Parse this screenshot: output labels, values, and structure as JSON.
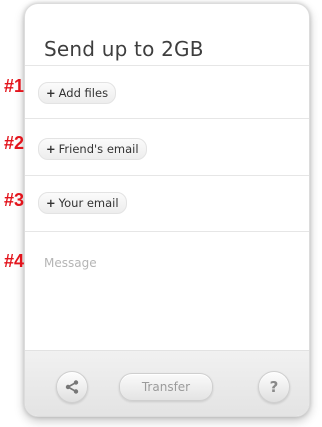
{
  "card": {
    "title": "Send up to 2GB",
    "add_files": "Add files",
    "friends_email": "Friend's email",
    "your_email": "Your email",
    "message_placeholder": "Message",
    "plus_glyph": "+"
  },
  "footer": {
    "transfer_label": "Transfer",
    "help_label": "?",
    "share_icon": "share-icon"
  },
  "markers": [
    "#1",
    "#2",
    "#3",
    "#4"
  ],
  "colors": {
    "marker": "#e3141c",
    "title": "#3e3e3e",
    "placeholder": "#b5b5b5"
  }
}
